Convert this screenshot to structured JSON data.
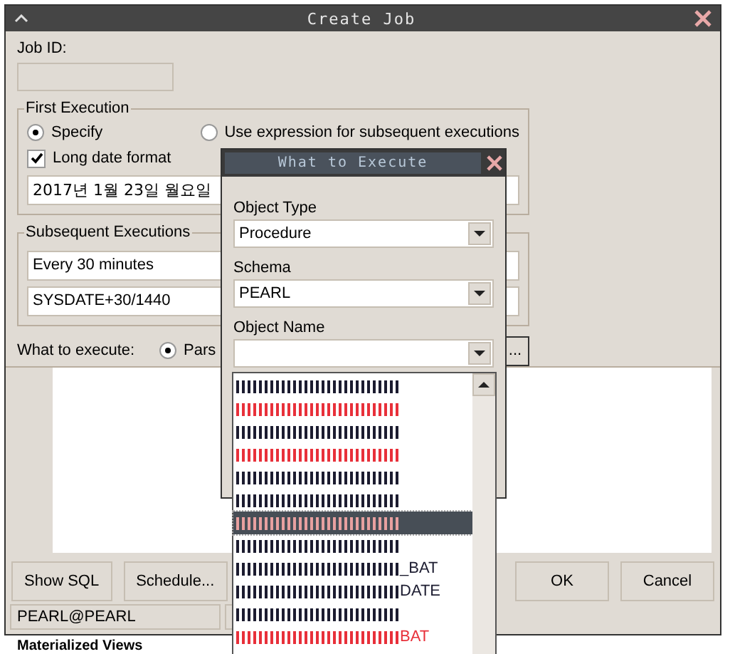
{
  "background_text": "Materialized Views",
  "main_window": {
    "title": "Create Job"
  },
  "job_id": {
    "label": "Job ID:"
  },
  "first_execution": {
    "title": "First Execution",
    "options": [
      {
        "label": "Specify",
        "selected": true
      },
      {
        "label": "Use expression for subsequent executions",
        "selected": false
      }
    ],
    "long_date_format": {
      "label": "Long date format",
      "checked": true
    },
    "date_value": "2017년  1월 23일 월요일"
  },
  "subsequent_executions": {
    "title": "Subsequent Executions",
    "interval": "Every 30 minutes",
    "expression": "SYSDATE+30/1440"
  },
  "what_to_execute": {
    "label": "What to execute:",
    "option": {
      "label": "Pars",
      "selected": true
    },
    "browse_button": "..."
  },
  "left_buttons": [
    "Show SQL",
    "Schedule..."
  ],
  "right_buttons": [
    "OK",
    "Cancel"
  ],
  "status_bar": [
    "PEARL@PEARL"
  ],
  "popup": {
    "title": "What to Execute",
    "fields": [
      {
        "label": "Object Type",
        "value": "Procedure"
      },
      {
        "label": "Schema",
        "value": "PEARL"
      },
      {
        "label": "Object Name"
      }
    ],
    "list": [
      {
        "color": "#1c1c30",
        "selected": false
      },
      {
        "color": "#e8303a",
        "selected": false
      },
      {
        "color": "#1c1c30",
        "selected": false
      },
      {
        "color": "#e8303a",
        "selected": false
      },
      {
        "color": "#1c1c30",
        "selected": false
      },
      {
        "color": "#1c1c30",
        "selected": false
      },
      {
        "color": "#e8a0a0",
        "selected": true
      },
      {
        "color": "#1c1c30",
        "selected": false
      },
      {
        "color": "#1c1c30",
        "selected": false,
        "suffix": "_BAT"
      },
      {
        "color": "#1c1c30",
        "selected": false,
        "suffix": "DATE"
      },
      {
        "color": "#1c1c30",
        "selected": false
      },
      {
        "color": "#e8303a",
        "selected": false,
        "suffix": "BAT"
      }
    ]
  }
}
